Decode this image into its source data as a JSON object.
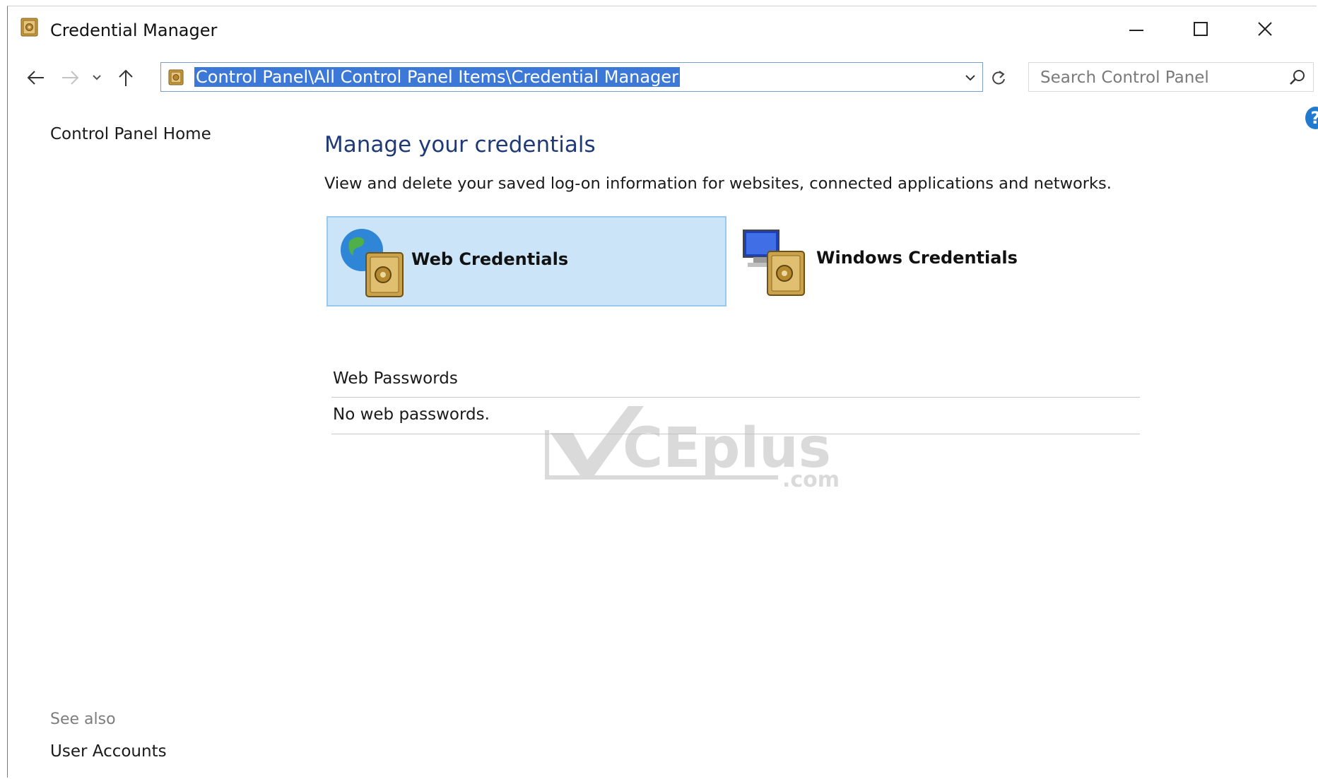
{
  "window": {
    "title": "Credential Manager"
  },
  "nav": {
    "address_path": "Control Panel\\All Control Panel Items\\Credential Manager",
    "search_placeholder": "Search Control Panel"
  },
  "sidebar": {
    "home_link": "Control Panel Home",
    "see_also_label": "See also",
    "see_also_items": [
      "User Accounts"
    ]
  },
  "main": {
    "heading": "Manage your credentials",
    "subtitle": "View and delete your saved log-on information for websites, connected applications and networks.",
    "tiles": [
      {
        "label": "Web Credentials",
        "icon": "globe-vault-icon",
        "selected": true
      },
      {
        "label": "Windows Credentials",
        "icon": "computer-vault-icon",
        "selected": false
      }
    ],
    "section_header": "Web Passwords",
    "empty_message": "No web passwords."
  },
  "watermark": {
    "brand": "CEplus",
    "suffix": ".com"
  },
  "colors": {
    "heading": "#1e3a78",
    "selection": "#3b78d8",
    "tile_selected_bg": "#cce4f7",
    "help": "#1f7ad0"
  }
}
